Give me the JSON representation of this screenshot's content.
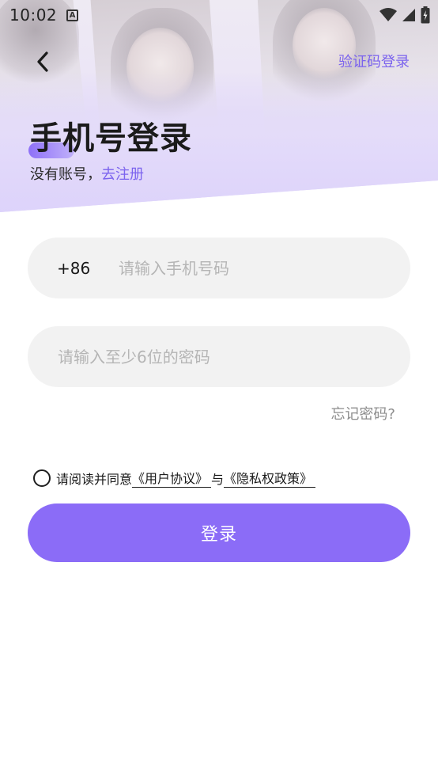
{
  "status_bar": {
    "time": "10:02",
    "notification_icon": "a-notification-icon",
    "icons": [
      "wifi-icon",
      "signal-icon",
      "battery-icon"
    ]
  },
  "nav": {
    "back_icon": "chevron-left-icon",
    "sms_login": "验证码登录"
  },
  "header": {
    "title": "手机号登录",
    "subtitle_prefix": "没有账号，",
    "register_link": "去注册"
  },
  "form": {
    "country_code": "+86",
    "phone_placeholder": "请输入手机号码",
    "phone_value": "",
    "password_placeholder": "请输入至少6位的密码",
    "password_value": "",
    "forgot_password": "忘记密码?"
  },
  "agreement": {
    "checked": false,
    "prefix": "请阅读并同意",
    "user_agreement": "《用户协议》",
    "conjunction": "与",
    "privacy_policy": "《隐私权政策》"
  },
  "login_button": "登录",
  "colors": {
    "accent": "#8b6cf7",
    "link": "#7b63ee",
    "input_bg": "#f2f2f2",
    "placeholder": "#b5b5b5",
    "hero_lavender": "#ddd3fb"
  }
}
